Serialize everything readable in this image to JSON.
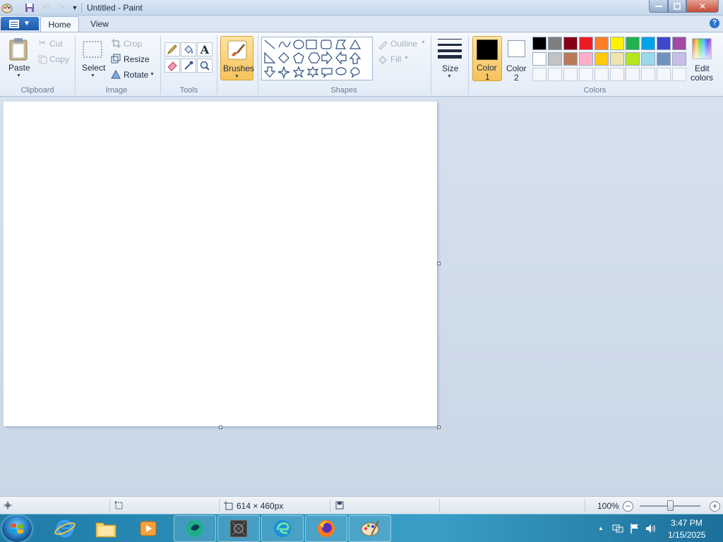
{
  "window": {
    "title": "Untitled - Paint",
    "min_icon": "minimize-icon",
    "max_icon": "maximize-icon",
    "close_icon": "close-icon"
  },
  "ribbon_tabs": {
    "home": "Home",
    "view": "View"
  },
  "clipboard": {
    "paste": "Paste",
    "cut": "Cut",
    "copy": "Copy",
    "group": "Clipboard"
  },
  "image": {
    "select": "Select",
    "crop": "Crop",
    "resize": "Resize",
    "rotate": "Rotate",
    "group": "Image"
  },
  "tools": {
    "group": "Tools"
  },
  "brushes": {
    "label": "Brushes"
  },
  "shapes": {
    "outline": "Outline",
    "fill": "Fill",
    "group": "Shapes"
  },
  "size": {
    "label": "Size"
  },
  "colors": {
    "color1_line1": "Color",
    "color1_line2": "1",
    "color2_line1": "Color",
    "color2_line2": "2",
    "edit_line1": "Edit",
    "edit_line2": "colors",
    "group": "Colors",
    "color1": "#000000",
    "color2": "#ffffff",
    "palette_row1": [
      "#000000",
      "#7f7f7f",
      "#880015",
      "#ed1c24",
      "#ff7f27",
      "#fff200",
      "#22b14c",
      "#00a2e8",
      "#3f48cc",
      "#a349a4"
    ],
    "palette_row2": [
      "#ffffff",
      "#c3c3c3",
      "#b97a57",
      "#ffaec9",
      "#ffc90e",
      "#efe4b0",
      "#b5e61d",
      "#99d9ea",
      "#7092be",
      "#c8bfe7"
    ]
  },
  "status": {
    "canvas_size": "614 × 460px",
    "zoom": "100%",
    "zoom_level": 0.5
  },
  "taskbar": {
    "time": "3:47 PM",
    "date": "1/15/2025"
  }
}
